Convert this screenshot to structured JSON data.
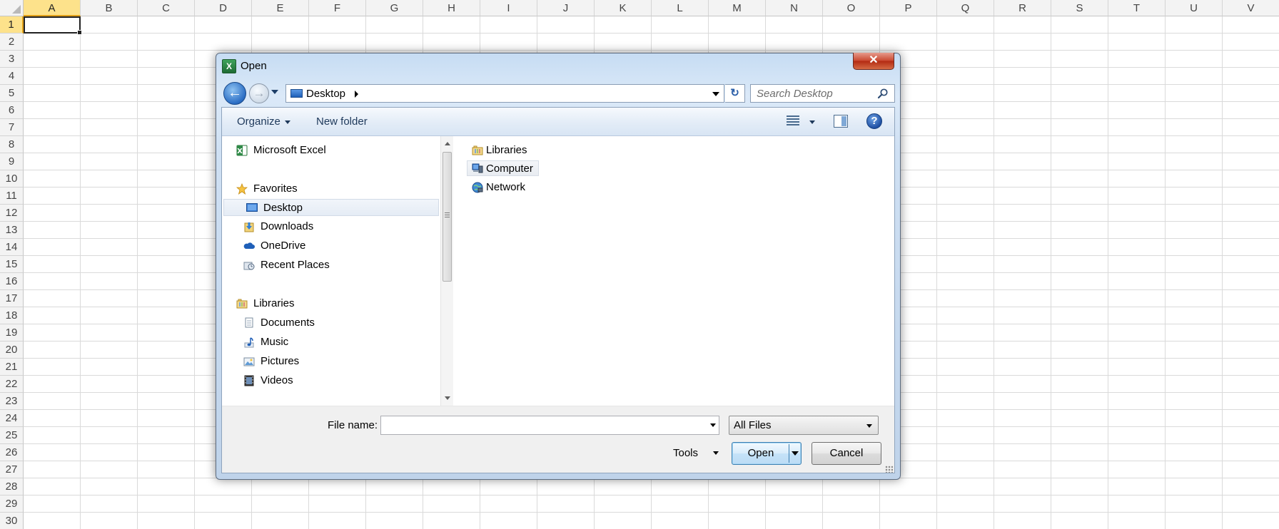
{
  "sheet": {
    "columns": [
      "A",
      "B",
      "C",
      "D",
      "E",
      "F",
      "G",
      "H",
      "I",
      "J",
      "K",
      "L",
      "M",
      "N",
      "O",
      "P",
      "Q",
      "R",
      "S",
      "T",
      "U",
      "V"
    ],
    "rows": [
      "1",
      "2",
      "3",
      "4",
      "5",
      "6",
      "7",
      "8",
      "9",
      "10",
      "11",
      "12",
      "13",
      "14",
      "15",
      "16",
      "17",
      "18",
      "19",
      "20",
      "21",
      "22",
      "23",
      "24",
      "25",
      "26",
      "27",
      "28",
      "29",
      "30"
    ],
    "selected_column": "A",
    "selected_row": "1"
  },
  "dialog": {
    "title": "Open",
    "app_icon_letter": "X",
    "close_glyph": "✕",
    "back_glyph": "←",
    "forward_glyph": "→",
    "refresh_glyph": "↻",
    "address": {
      "location": "Desktop"
    },
    "search": {
      "placeholder": "Search Desktop"
    },
    "toolbar": {
      "organize_label": "Organize",
      "new_folder_label": "New folder",
      "help_glyph": "?"
    },
    "nav": {
      "microsoft_excel": "Microsoft Excel",
      "favorites": "Favorites",
      "desktop": "Desktop",
      "downloads": "Downloads",
      "onedrive": "OneDrive",
      "recent_places": "Recent Places",
      "libraries": "Libraries",
      "documents": "Documents",
      "music": "Music",
      "pictures": "Pictures",
      "videos": "Videos",
      "selected": "Desktop"
    },
    "files": [
      "Libraries",
      "Computer",
      "Network"
    ],
    "bottom": {
      "file_name_label": "File name:",
      "file_name_value": "",
      "file_type": "All Files",
      "tools_label": "Tools",
      "open_label": "Open",
      "cancel_label": "Cancel"
    }
  }
}
